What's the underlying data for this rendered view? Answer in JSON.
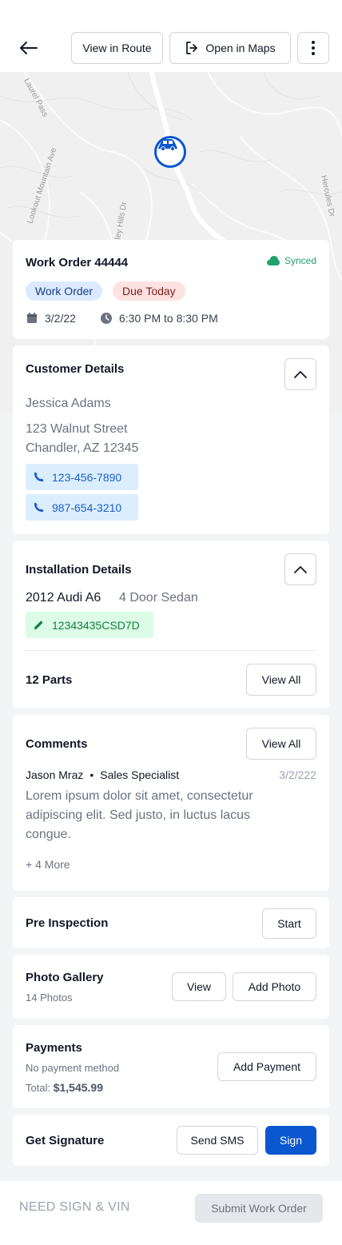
{
  "header": {
    "view_route_label": "View in Route",
    "open_maps_label": "Open in Maps"
  },
  "map": {
    "streets": [
      "Laurel Pass",
      "Lookout Mountain Ave",
      "ley Hills Dr",
      "Hercules Dr"
    ]
  },
  "work_order": {
    "title": "Work Order 44444",
    "sync_status": "Synced",
    "badges": [
      "Work Order",
      "Due Today"
    ],
    "date": "3/2/22",
    "time": "6:30 PM to 8:30 PM"
  },
  "customer": {
    "title": "Customer Details",
    "name": "Jessica Adams",
    "address_line1": "123 Walnut Street",
    "address_line2": "Chandler, AZ 12345",
    "phones": [
      "123-456-7890",
      "987-654-3210"
    ]
  },
  "installation": {
    "title": "Installation Details",
    "vehicle": "2012 Audi A6",
    "body": "4 Door Sedan",
    "vin": "12343435CSD7D",
    "parts_label": "12 Parts",
    "view_all_label": "View All"
  },
  "comments": {
    "title": "Comments",
    "view_all_label": "View All",
    "author": "Jason Mraz",
    "separator": "•",
    "role": "Sales Specialist",
    "date": "3/2/222",
    "body_line1": "Lorem ipsum dolor sit amet, consectetur",
    "body_line2": "adipiscing elit. Sed justo, in luctus lacus",
    "body_line3": "congue.",
    "more": "+ 4 More"
  },
  "pre_inspection": {
    "title": "Pre Inspection",
    "start_label": "Start"
  },
  "photo_gallery": {
    "title": "Photo Gallery",
    "count": "14 Photos",
    "view_label": "View",
    "add_label": "Add Photo"
  },
  "payments": {
    "title": "Payments",
    "method": "No payment method",
    "total_label": "Total:",
    "total_value": "$1,545.99",
    "add_label": "Add Payment"
  },
  "signature": {
    "title": "Get Signature",
    "sms_label": "Send SMS",
    "sign_label": "Sign"
  },
  "footer": {
    "status": "NEED SIGN & VIN",
    "submit_label": "Submit Work Order"
  },
  "colors": {
    "primary": "#0b57d0",
    "synced": "#22a06b",
    "badge_blue_bg": "#dbeafe",
    "badge_red_bg": "#fee2e2",
    "chip_blue_bg": "#dbeefe",
    "chip_green_bg": "#dcfce7"
  }
}
